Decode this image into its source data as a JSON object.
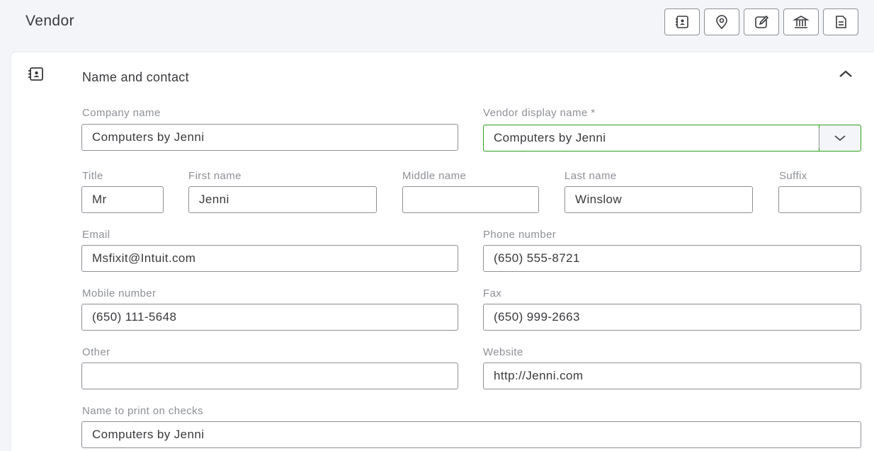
{
  "header": {
    "title": "Vendor",
    "toolbar": [
      {
        "name": "contact-card-icon"
      },
      {
        "name": "location-pin-icon"
      },
      {
        "name": "edit-note-icon"
      },
      {
        "name": "bank-icon"
      },
      {
        "name": "document-icon"
      }
    ]
  },
  "section": {
    "title": "Name and contact",
    "icon": "contact-card-icon",
    "collapse_icon": "chevron-up-icon"
  },
  "form": {
    "company_name": {
      "label": "Company name",
      "value": "Computers by Jenni"
    },
    "display_name": {
      "label": "Vendor display name *",
      "value": "Computers by Jenni"
    },
    "title": {
      "label": "Title",
      "value": "Mr"
    },
    "first_name": {
      "label": "First name",
      "value": "Jenni"
    },
    "middle_name": {
      "label": "Middle name",
      "value": ""
    },
    "last_name": {
      "label": "Last name",
      "value": "Winslow"
    },
    "suffix": {
      "label": "Suffix",
      "value": ""
    },
    "email": {
      "label": "Email",
      "value": "Msfixit@Intuit.com"
    },
    "phone": {
      "label": "Phone number",
      "value": "(650) 555-8721"
    },
    "mobile": {
      "label": "Mobile number",
      "value": "(650) 111-5648"
    },
    "fax": {
      "label": "Fax",
      "value": "(650) 999-2663"
    },
    "other": {
      "label": "Other",
      "value": ""
    },
    "website": {
      "label": "Website",
      "value": "http://Jenni.com"
    },
    "print_on_checks": {
      "label": "Name to print on checks",
      "value": "Computers by Jenni"
    }
  },
  "colors": {
    "accent_green": "#2ca01c",
    "border_gray": "#8d9096",
    "text_dark": "#393a3d"
  }
}
